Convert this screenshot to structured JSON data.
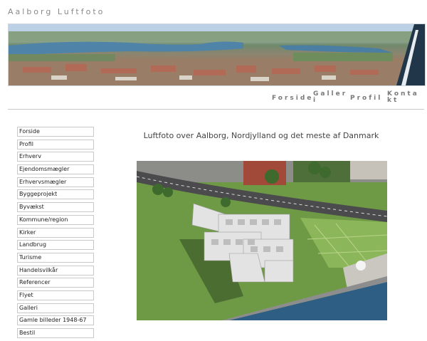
{
  "site": {
    "title": "Aalborg Luftfoto"
  },
  "nav": [
    {
      "label": "Forside"
    },
    {
      "label": "Galleri"
    },
    {
      "label": "Profil"
    },
    {
      "label": "Kontakt"
    }
  ],
  "sidebar": {
    "items": [
      {
        "label": "Forside"
      },
      {
        "label": "Profil"
      },
      {
        "label": "Erhverv"
      },
      {
        "label": "Ejendomsmægler"
      },
      {
        "label": "Erhvervsmægler"
      },
      {
        "label": "Byggeprojekt"
      },
      {
        "label": "Byvækst"
      },
      {
        "label": "Kommune/region"
      },
      {
        "label": "Kirker"
      },
      {
        "label": "Landbrug"
      },
      {
        "label": "Turisme"
      },
      {
        "label": "Handelsvilkår"
      },
      {
        "label": "Referencer"
      },
      {
        "label": "Flyet"
      },
      {
        "label": "Galleri"
      },
      {
        "label": "Gamle billeder 1948-67"
      },
      {
        "label": "Bestil"
      }
    ]
  },
  "main": {
    "headline": "Luftfoto over Aalborg, Nordjylland og det meste af Danmark"
  },
  "colors": {
    "accent": "#7a7a7a",
    "border": "#c9c9c9",
    "water": "#3d6f95"
  }
}
